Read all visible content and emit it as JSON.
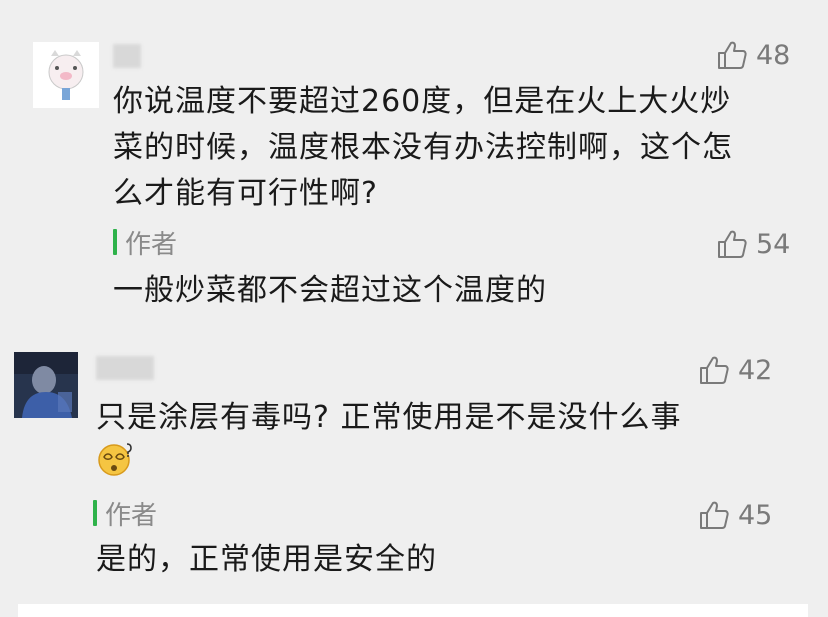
{
  "comments": [
    {
      "text_lines": [
        "你说温度不要超过260度，但是在火上大火炒",
        "菜的时候，温度根本没有办法控制啊，这个怎",
        "么才能有可行性啊?"
      ],
      "likes": "48",
      "reply": {
        "author_label": "作者",
        "text": "一般炒菜都不会超过这个温度的",
        "likes": "54"
      }
    },
    {
      "text_line": "只是涂层有毒吗? 正常使用是不是没什么事",
      "emoji": "dizzy-face-emoji",
      "likes": "42",
      "reply": {
        "author_label": "作者",
        "text": "是的，正常使用是安全的",
        "likes": "45"
      }
    }
  ],
  "colors": {
    "background": "#efefef",
    "author_bar": "#2eb24a",
    "muted_text": "#8a8a8a"
  },
  "icons": {
    "like": "thumbs-up-icon"
  }
}
